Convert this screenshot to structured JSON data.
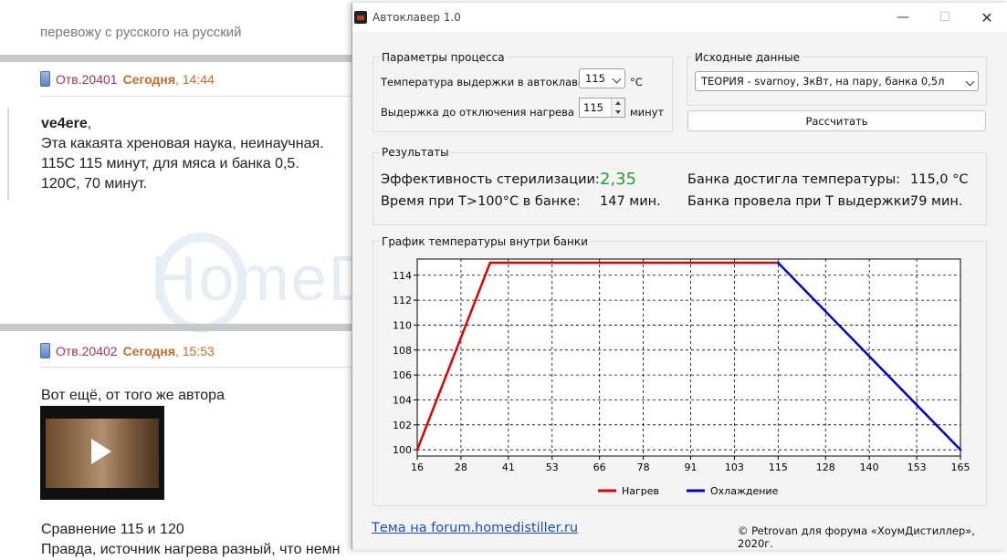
{
  "forum": {
    "top_line": "перевожу с русского на русский",
    "posts": [
      {
        "number": "Отв.20401",
        "day": "Сегодня",
        "time": "14:44",
        "author": "ve4ere",
        "lines": [
          "Эта какаята хреновая наука, неинаучная.",
          "115С 115 минут, для мяса и банка 0,5.",
          "120С, 70 минут."
        ]
      },
      {
        "number": "Отв.20402",
        "day": "Сегодня",
        "time": "15:53",
        "lines": [
          "Вот ещё, от того же автора"
        ],
        "after_video": [
          "Сравнение 115 и 120",
          "Правда, источник нагрева разный, что немн"
        ]
      }
    ],
    "watermark": "HomeDistiller.ru"
  },
  "window": {
    "title": "Автоклавер 1.0",
    "controls": {
      "minimize": "—",
      "maximize": "☐",
      "close": "✕"
    },
    "params": {
      "group_label": "Параметры процесса",
      "temp_label": "Температура выдержки в автоклаве",
      "temp_value": "115",
      "temp_unit": "°C",
      "hold_label": "Выдержка до отключения нагрева",
      "hold_value": "115",
      "hold_unit": "минут"
    },
    "source": {
      "group_label": "Исходные данные",
      "selected": "ТЕОРИЯ - svarnoy, 3кВт, на пару, банка 0,5л",
      "calc_button": "Рассчитать"
    },
    "results": {
      "group_label": "Результаты",
      "efficiency_label": "Эффективность стерилизации:",
      "efficiency_value": "2,35",
      "time_label": "Время при T>100°C в банке:",
      "time_value": "147 мин.",
      "reached_label": "Банка достигла температуры:",
      "reached_value": "115,0 °C",
      "held_label": "Банка провела при Т выдержки:",
      "held_value": "79 мин."
    },
    "chart_group_label": "График температуры внутри банки",
    "footer": {
      "link": "Тема на forum.homedistiller.ru",
      "copyright": "© Petrovan для форума «ХоумДистиллер», 2020г."
    },
    "colors": {
      "heating": "#e00000",
      "cooling": "#0000cc",
      "efficiency": "#2aa030"
    }
  },
  "chart_data": {
    "type": "line",
    "title": "График температуры внутри банки",
    "xlim": [
      16,
      165
    ],
    "ylim": [
      99.5,
      115.3
    ],
    "xticks": [
      16,
      28,
      41,
      53,
      66,
      78,
      91,
      103,
      115,
      128,
      140,
      153,
      165
    ],
    "yticks": [
      100,
      102,
      104,
      106,
      108,
      110,
      112,
      114
    ],
    "grid": true,
    "legend_position": "bottom",
    "series": [
      {
        "name": "Нагрев",
        "color": "#e00000",
        "x": [
          16,
          36,
          115
        ],
        "y": [
          100,
          115,
          115
        ]
      },
      {
        "name": "Охлаждение",
        "color": "#0000cc",
        "x": [
          115,
          165
        ],
        "y": [
          115,
          100
        ]
      }
    ]
  }
}
